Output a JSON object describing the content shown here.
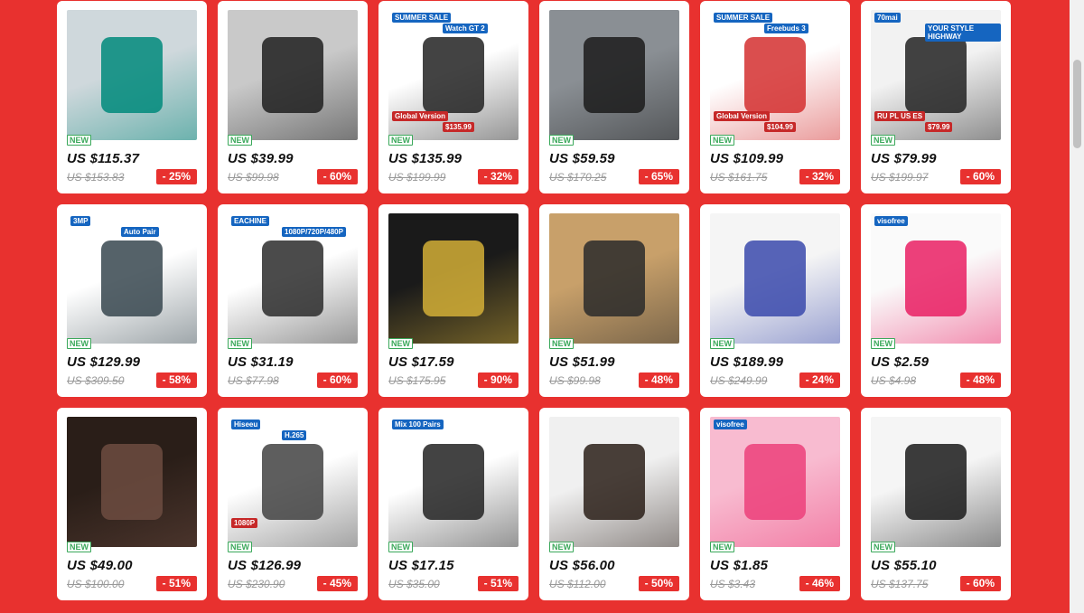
{
  "products": [
    {
      "price": "US $115.37",
      "original": "US $153.83",
      "discount": "- 25%",
      "badge": "NEW",
      "image": "smartphone-teal",
      "bg": "#cfd8dc",
      "fg": "#00897b"
    },
    {
      "price": "US $39.99",
      "original": "US $99.98",
      "discount": "- 60%",
      "badge": "NEW",
      "image": "handheld-vacuum",
      "bg": "#c9c9c9",
      "fg": "#1e1e1e"
    },
    {
      "price": "US $135.99",
      "original": "US $199.99",
      "discount": "- 32%",
      "badge": "NEW",
      "image": "smartwatch",
      "bg": "#ffffff",
      "fg": "#222222",
      "overlay": [
        "SUMMER SALE",
        "Watch GT 2",
        "Global Version",
        "$135.99"
      ]
    },
    {
      "price": "US $59.59",
      "original": "US $170.25",
      "discount": "- 65%",
      "badge": "NEW",
      "image": "car-interior",
      "bg": "#8a8f94",
      "fg": "#1b1b1b"
    },
    {
      "price": "US $109.99",
      "original": "US $161.75",
      "discount": "- 32%",
      "badge": "NEW",
      "image": "earbuds-red",
      "bg": "#ffffff",
      "fg": "#d32f2f",
      "overlay": [
        "SUMMER SALE",
        "Freebuds 3",
        "Global Version",
        "$104.99"
      ]
    },
    {
      "price": "US $79.99",
      "original": "US $199.97",
      "discount": "- 60%",
      "badge": "NEW",
      "image": "jump-starter",
      "bg": "#f2f2f2",
      "fg": "#222222",
      "overlay": [
        "70mai",
        "YOUR STYLE HIGHWAY",
        "RU PL US ES",
        "$79.99"
      ]
    },
    {
      "price": "US $129.99",
      "original": "US $309.50",
      "discount": "- 58%",
      "badge": "NEW",
      "image": "security-camera-kit",
      "bg": "#ffffff",
      "fg": "#37474f",
      "overlay": [
        "3MP",
        "Auto Pair"
      ]
    },
    {
      "price": "US $31.19",
      "original": "US $77.98",
      "discount": "- 60%",
      "badge": "NEW",
      "image": "drone",
      "bg": "#ffffff",
      "fg": "#2b2b2b",
      "overlay": [
        "EACHINE",
        "1080P/720P/480P"
      ]
    },
    {
      "price": "US $17.59",
      "original": "US $175.95",
      "discount": "- 90%",
      "badge": "NEW",
      "image": "gold-watch",
      "bg": "#1a1a1a",
      "fg": "#d4af37"
    },
    {
      "price": "US $51.99",
      "original": "US $99.98",
      "discount": "- 48%",
      "badge": "NEW",
      "image": "dash-cam",
      "bg": "#c8a06a",
      "fg": "#2a2a2a"
    },
    {
      "price": "US $189.99",
      "original": "US $249.99",
      "discount": "- 24%",
      "badge": "NEW",
      "image": "smartphone-blue",
      "bg": "#f5f5f5",
      "fg": "#3949ab"
    },
    {
      "price": "US $2.59",
      "original": "US $4.98",
      "discount": "- 48%",
      "badge": "NEW",
      "image": "eyelashes",
      "bg": "#fafafa",
      "fg": "#e91e63",
      "overlay": [
        "visofree"
      ]
    },
    {
      "price": "US $49.00",
      "original": "US $100.00",
      "discount": "- 51%",
      "badge": "NEW",
      "image": "curly-wig",
      "bg": "#2a1e18",
      "fg": "#6d4c41"
    },
    {
      "price": "US $126.99",
      "original": "US $230.90",
      "discount": "- 45%",
      "badge": "NEW",
      "image": "camera-system",
      "bg": "#ffffff",
      "fg": "#424242",
      "overlay": [
        "Hiseeu",
        "H.265",
        "1080P"
      ]
    },
    {
      "price": "US $17.15",
      "original": "US $35.00",
      "discount": "- 51%",
      "badge": "NEW",
      "image": "lash-box",
      "bg": "#ffffff",
      "fg": "#222222",
      "overlay": [
        "Mix 100 Pairs"
      ]
    },
    {
      "price": "US $56.00",
      "original": "US $112.00",
      "discount": "- 50%",
      "badge": "NEW",
      "image": "short-curly-wig",
      "bg": "#f0f0f0",
      "fg": "#2a1e18"
    },
    {
      "price": "US $1.85",
      "original": "US $3.43",
      "discount": "- 46%",
      "badge": "NEW",
      "image": "lash-packs",
      "bg": "#f8bbd0",
      "fg": "#ec407a",
      "overlay": [
        "visofree"
      ]
    },
    {
      "price": "US $55.10",
      "original": "US $137.75",
      "discount": "- 60%",
      "badge": "NEW",
      "image": "hair-bundles",
      "bg": "#f5f5f5",
      "fg": "#1a1a1a"
    }
  ]
}
